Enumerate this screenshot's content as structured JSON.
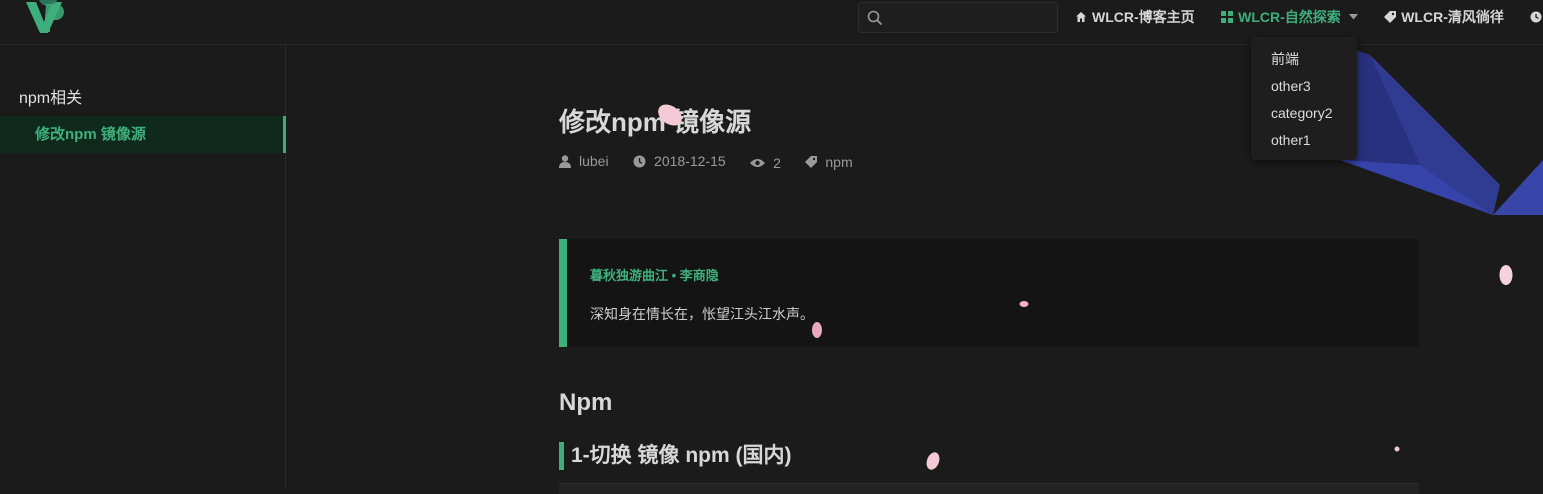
{
  "navbar": {
    "search": {
      "placeholder": "",
      "value": ""
    },
    "links": [
      {
        "label": "WLCR-博客主页",
        "icon": "home-icon"
      },
      {
        "label": "WLCR-自然探索",
        "icon": "grid-icon",
        "active": true,
        "has_dropdown": true
      },
      {
        "label": "WLCR-清风徜徉",
        "icon": "tag-icon"
      }
    ],
    "dropdown_items": [
      "前端",
      "other3",
      "category2",
      "other1"
    ]
  },
  "sidebar": {
    "group_title": "npm相关",
    "active_link": "修改npm 镜像源"
  },
  "article": {
    "title": "修改npm 镜像源",
    "meta": {
      "author": "lubei",
      "date": "2018-12-15",
      "views": "2",
      "tag": "npm"
    },
    "quote": {
      "title": "暮秋独游曲江 • 李商隐",
      "text": "深知身在情长在，怅望江头江水声。"
    },
    "h2": "Npm",
    "h3": "1-切换 镜像 npm (国内)"
  },
  "colors": {
    "accent": "#3eaf7c",
    "background": "#1b1b1b",
    "quote_bg": "#141414",
    "decor_blue": "#3b4bb8"
  }
}
